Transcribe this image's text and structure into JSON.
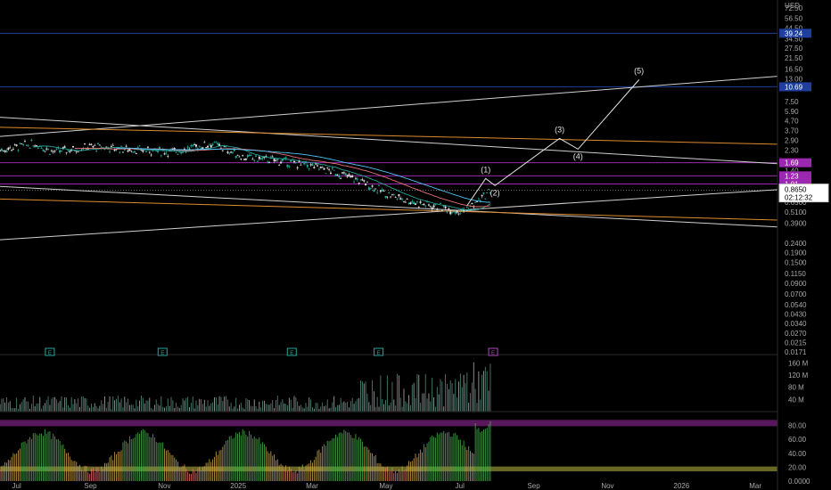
{
  "chart_data": {
    "type": "candlestick",
    "currency_label": "USD",
    "price_scale": "log",
    "price_ticks": [
      "72.50",
      "56.50",
      "44.50",
      "34.50",
      "27.50",
      "21.50",
      "16.50",
      "13.00",
      "7.50",
      "5.90",
      "4.70",
      "3.70",
      "2.90",
      "2.30",
      "1.40",
      "0.6500",
      "0.5100",
      "0.3900",
      "0.2400",
      "0.1900",
      "0.1500",
      "0.1150",
      "0.0900",
      "0.0700",
      "0.0540",
      "0.0430",
      "0.0340",
      "0.0270",
      "0.0215",
      "0.0171"
    ],
    "price_tick_values": [
      72.5,
      56.5,
      44.5,
      34.5,
      27.5,
      21.5,
      16.5,
      13.0,
      7.5,
      5.9,
      4.7,
      3.7,
      2.9,
      2.3,
      1.4,
      0.65,
      0.51,
      0.39,
      0.24,
      0.19,
      0.15,
      0.115,
      0.09,
      0.07,
      0.054,
      0.043,
      0.034,
      0.027,
      0.0215,
      0.0171
    ],
    "price_range": [
      0.016,
      88
    ],
    "time_labels": [
      "Jul",
      "Sep",
      "Nov",
      "2025",
      "Mar",
      "May",
      "Jul",
      "Sep",
      "Nov",
      "2026",
      "Mar"
    ],
    "time_label_months": [
      0,
      2,
      4,
      6,
      8,
      10,
      12,
      14,
      16,
      18,
      20
    ],
    "time_range_months": [
      -0.45,
      20.6
    ],
    "current_price": "0.8650",
    "countdown": "02:12:32",
    "level_labels": [
      {
        "text": "39.24",
        "value": 39.24,
        "color": "#1e3f9e"
      },
      {
        "text": "10.69",
        "value": 10.69,
        "color": "#1e3f9e"
      },
      {
        "text": "1.69",
        "value": 1.69,
        "color": "#9c27b0"
      },
      {
        "text": "1.23",
        "value": 1.23,
        "color": "#9c27b0"
      },
      {
        "text": "1.01",
        "value": 1.01,
        "color": "#9c27b0"
      }
    ],
    "wave_labels": [
      "(1)",
      "(2)",
      "(3)",
      "(4)",
      "(5)"
    ],
    "wave_points": [
      {
        "t": 12.2,
        "p": 0.6
      },
      {
        "t": 12.7,
        "p": 1.15
      },
      {
        "t": 12.95,
        "p": 0.97
      },
      {
        "t": 14.7,
        "p": 3.05
      },
      {
        "t": 15.2,
        "p": 2.35
      },
      {
        "t": 16.85,
        "p": 12.7
      }
    ],
    "volume_ticks": [
      "160 M",
      "120 M",
      "80 M",
      "40 M"
    ],
    "volume_tick_values": [
      160,
      120,
      80,
      40
    ],
    "volume_range": [
      0,
      170
    ],
    "oscillator_ticks": [
      "80.00",
      "60.00",
      "40.00",
      "20.00",
      "0.0000"
    ],
    "oscillator_tick_values": [
      80,
      60,
      40,
      20,
      0
    ],
    "oscillator_range": [
      0,
      100
    ],
    "oscillator_bands": [
      {
        "from": 79,
        "to": 88,
        "color": "#6a1b6e"
      },
      {
        "from": 14,
        "to": 21,
        "color": "#7a7a2a"
      }
    ],
    "event_markers": [
      {
        "text": "E",
        "t": 0.9,
        "color": "#26a69a"
      },
      {
        "text": "E",
        "t": 3.95,
        "color": "#26a69a"
      },
      {
        "text": "E",
        "t": 7.45,
        "color": "#26a69a"
      },
      {
        "text": "E",
        "t": 9.8,
        "color": "#26a69a"
      },
      {
        "text": "E",
        "t": 12.9,
        "color": "#ab47bc"
      }
    ],
    "colors": {
      "up": "#26a69a",
      "down": "#e0e0e0",
      "trendline": "#d0d0d0",
      "orange": "#e08a2c",
      "blue": "#2e4bd0",
      "purple": "#b23fce"
    }
  }
}
